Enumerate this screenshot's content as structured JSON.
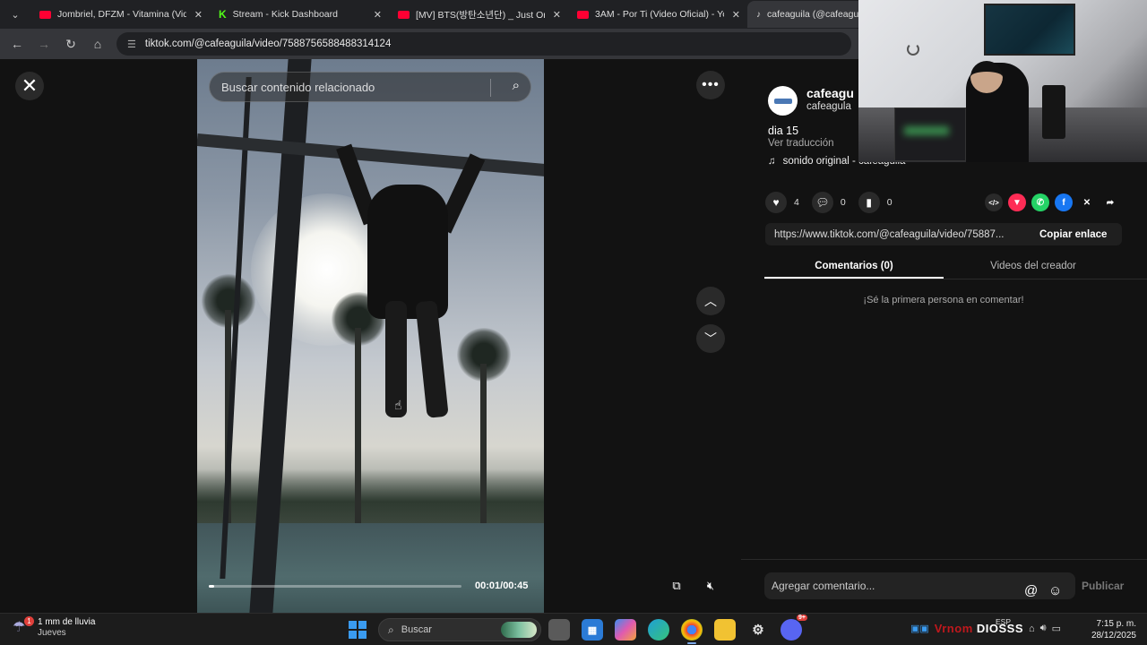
{
  "browser": {
    "tabs": [
      {
        "title": "Jombriel, DFZM - Vitamina (Vid",
        "favicon": "youtube"
      },
      {
        "title": "Stream - Kick Dashboard",
        "favicon": "kick"
      },
      {
        "title": "[MV] BTS(방탄소년단) _ Just On",
        "favicon": "youtube"
      },
      {
        "title": "3AM - Por Ti (Video Oficial) - Yo",
        "favicon": "youtube"
      },
      {
        "title": "cafeaguila (@cafeaguila",
        "favicon": "tiktok",
        "active": true
      }
    ],
    "url": "tiktok.com/@cafeaguila/video/7588756588488314124"
  },
  "video": {
    "search_placeholder": "Buscar contenido relacionado",
    "time": "00:01/00:45",
    "progress_fraction": 0.022
  },
  "panel": {
    "creator_name": "cafeagu",
    "creator_handle": "cafeagula",
    "caption": "dia 15",
    "translate_label": "Ver traducción",
    "sound": "sonido original - cafeaguila",
    "likes": "4",
    "comments": "0",
    "saves": "0",
    "share_link": "https://www.tiktok.com/@cafeaguila/video/75887...",
    "copy_label": "Copiar enlace",
    "tab_comments": "Comentarios (0)",
    "tab_creator_videos": "Videos del creador",
    "empty_message": "¡Sé la primera persona en comentar!",
    "comment_placeholder": "Agregar comentario...",
    "publish_label": "Publicar"
  },
  "taskbar": {
    "weather_badge": "1",
    "weather_text": "1 mm de lluvia",
    "weather_day": "Jueves",
    "search_label": "Buscar",
    "discord_badge": "9+",
    "tray_brand_red": "Vrnom",
    "tray_brand": "DIOSSS",
    "language": "ESP",
    "time": "7:15 p. m.",
    "date": "28/12/2025"
  },
  "colors": {
    "accent_youtube": "#ff0033",
    "accent_kick": "#53fc18",
    "windows_blue": "#3a9bf0"
  }
}
